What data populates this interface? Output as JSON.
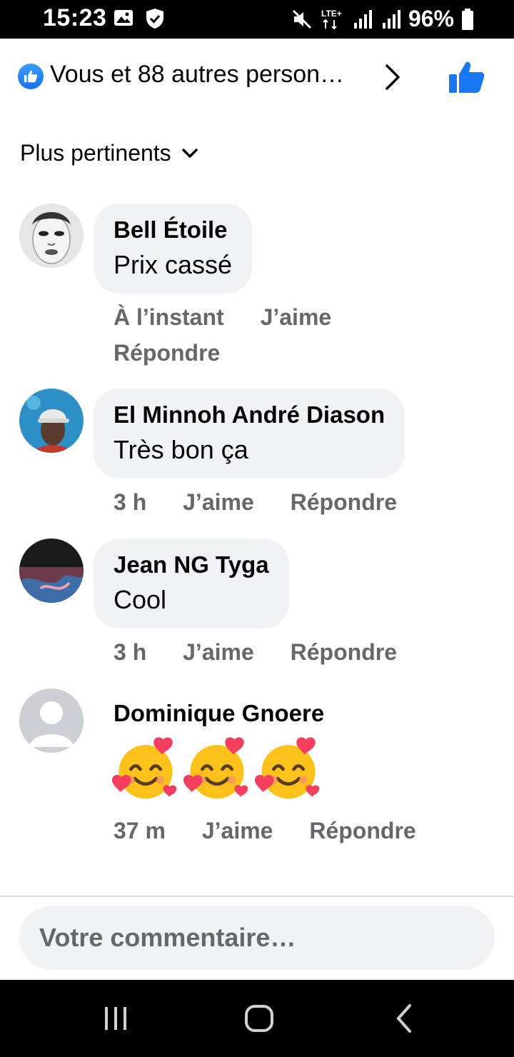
{
  "status_bar": {
    "time": "15:23",
    "battery": "96%",
    "network": "LTE+"
  },
  "reactions": {
    "summary": "Vous et 88 autres person…",
    "icon": "like-icon"
  },
  "sort": {
    "label": "Plus pertinents"
  },
  "comments": [
    {
      "author": "Bell Étoile",
      "text": "Prix cassé",
      "time": "À l’instant",
      "like": "J’aime",
      "reply": "Répondre"
    },
    {
      "author": "El Minnoh André Diason",
      "text": "Très bon ça",
      "time": "3 h",
      "like": "J’aime",
      "reply": "Répondre"
    },
    {
      "author": "Jean NG Tyga",
      "text": "Cool",
      "time": "3 h",
      "like": "J’aime",
      "reply": "Répondre"
    },
    {
      "author": "Dominique Gnoere",
      "text": "🥰🥰🥰",
      "time": "37 m",
      "like": "J’aime",
      "reply": "Répondre"
    }
  ],
  "composer": {
    "placeholder": "Votre commentaire…"
  },
  "colors": {
    "brand_blue": "#1877f2",
    "bubble_bg": "#f0f2f5",
    "meta_gray": "#65676b"
  }
}
